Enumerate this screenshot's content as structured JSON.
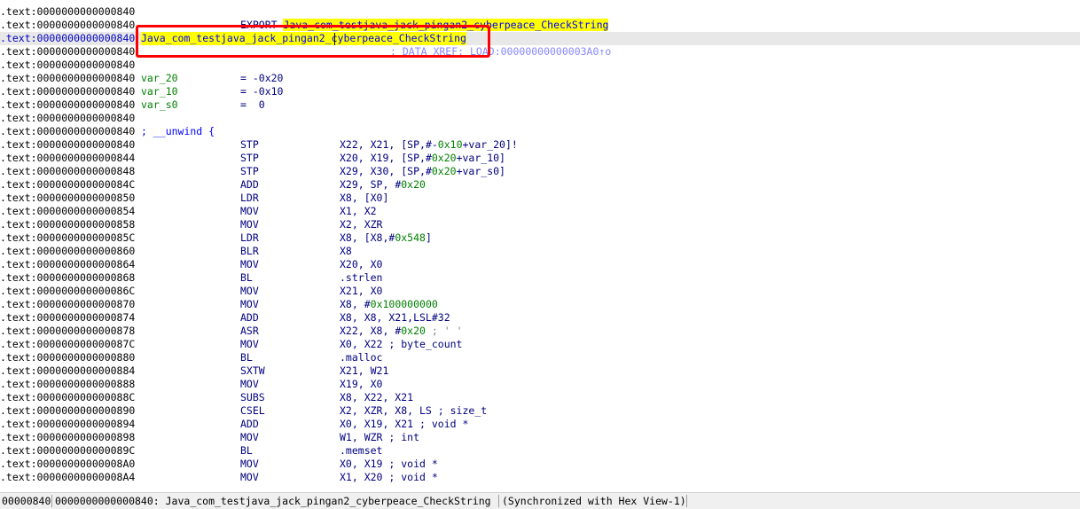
{
  "disassembly": {
    "lines": [
      {
        "addr": ".text:0000000000000840"
      },
      {
        "addr": ".text:0000000000000840",
        "export_kw": "EXPORT ",
        "export_name": "Java_com_testjava_jack_pingan2_cyberpeace_CheckString"
      },
      {
        "addr": ".text:0000000000000840",
        "label": "Java_com_testjava_jack_pingan2_cyberpeace_CheckString",
        "selected": true
      },
      {
        "addr": ".text:0000000000000840",
        "xref": "; DATA XREF: LOAD:00000000000003A0↑o"
      },
      {
        "addr": ".text:0000000000000840"
      },
      {
        "addr": ".text:0000000000000840",
        "var": "var_20",
        "eq": "= -0x20"
      },
      {
        "addr": ".text:0000000000000840",
        "var": "var_10",
        "eq": "= -0x10"
      },
      {
        "addr": ".text:0000000000000840",
        "var": "var_s0",
        "eq": "=  0"
      },
      {
        "addr": ".text:0000000000000840"
      },
      {
        "addr": ".text:0000000000000840",
        "label": "; __unwind {"
      },
      {
        "addr": ".text:0000000000000840",
        "mn": "STP",
        "op": "X22, X21, [SP,#-0x10+var_20]!"
      },
      {
        "addr": ".text:0000000000000844",
        "mn": "STP",
        "op": "X20, X19, [SP,#0x20+var_10]"
      },
      {
        "addr": ".text:0000000000000848",
        "mn": "STP",
        "op": "X29, X30, [SP,#0x20+var_s0]"
      },
      {
        "addr": ".text:000000000000084C",
        "mn": "ADD",
        "op": "X29, SP, #0x20"
      },
      {
        "addr": ".text:0000000000000850",
        "mn": "LDR",
        "op": "X8, [X0]"
      },
      {
        "addr": ".text:0000000000000854",
        "mn": "MOV",
        "op": "X1, X2"
      },
      {
        "addr": ".text:0000000000000858",
        "mn": "MOV",
        "op": "X2, XZR"
      },
      {
        "addr": ".text:000000000000085C",
        "mn": "LDR",
        "op": "X8, [X8,#0x548]"
      },
      {
        "addr": ".text:0000000000000860",
        "mn": "BLR",
        "op": "X8"
      },
      {
        "addr": ".text:0000000000000864",
        "mn": "MOV",
        "op": "X20, X0"
      },
      {
        "addr": ".text:0000000000000868",
        "mn": "BL",
        "op": ".strlen"
      },
      {
        "addr": ".text:000000000000086C",
        "mn": "MOV",
        "op": "X21, X0"
      },
      {
        "addr": ".text:0000000000000870",
        "mn": "MOV",
        "op": "X8, #0x100000000"
      },
      {
        "addr": ".text:0000000000000874",
        "mn": "ADD",
        "op": "X8, X8, X21,LSL#32"
      },
      {
        "addr": ".text:0000000000000878",
        "mn": "ASR",
        "op": "X22, X8, #0x20",
        "cmt": " ; ' '"
      },
      {
        "addr": ".text:000000000000087C",
        "mn": "MOV",
        "op": "X0, X22 ; byte_count"
      },
      {
        "addr": ".text:0000000000000880",
        "mn": "BL",
        "op": ".malloc"
      },
      {
        "addr": ".text:0000000000000884",
        "mn": "SXTW",
        "op": "X21, W21"
      },
      {
        "addr": ".text:0000000000000888",
        "mn": "MOV",
        "op": "X19, X0"
      },
      {
        "addr": ".text:000000000000088C",
        "mn": "SUBS",
        "op": "X8, X22, X21"
      },
      {
        "addr": ".text:0000000000000890",
        "mn": "CSEL",
        "op": "X2, XZR, X8, LS ; size_t"
      },
      {
        "addr": ".text:0000000000000894",
        "mn": "ADD",
        "op": "X0, X19, X21 ; void *"
      },
      {
        "addr": ".text:0000000000000898",
        "mn": "MOV",
        "op": "W1, WZR ; int"
      },
      {
        "addr": ".text:000000000000089C",
        "mn": "BL",
        "op": ".memset"
      },
      {
        "addr": ".text:00000000000008A0",
        "mn": "MOV",
        "op": "X0, X19 ; void *"
      },
      {
        "addr": ".text:00000000000008A4",
        "mn": "MOV",
        "op": "X1, X20 ; void *"
      }
    ]
  },
  "status_bar": {
    "offset": "00000840",
    "location": "0000000000000840: Java_com_testjava_jack_pingan2_cyberpeace_CheckString",
    "sync": "(Synchronized with Hex View-1)"
  },
  "colors": {
    "label": "#0000ff",
    "highlight": "#ffff00",
    "selection_box": "#ff0000",
    "variable": "#008000"
  }
}
